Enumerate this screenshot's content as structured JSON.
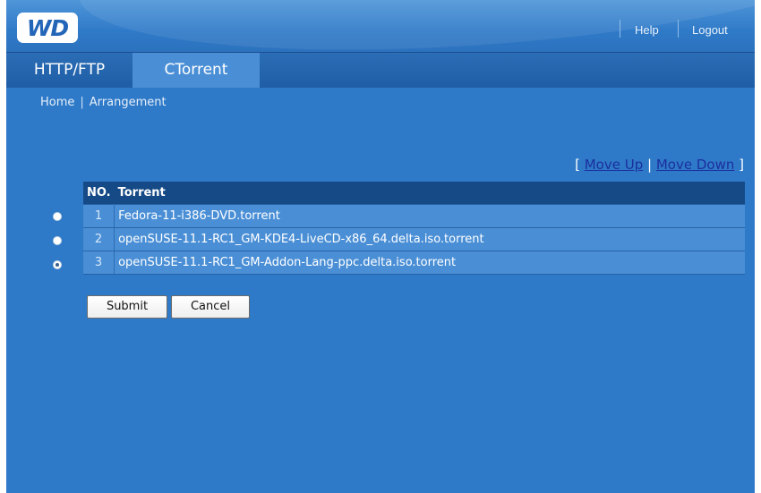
{
  "header": {
    "logo_text": "WD",
    "help_label": "Help",
    "logout_label": "Logout"
  },
  "tabs": [
    {
      "label": "HTTP/FTP",
      "active": false
    },
    {
      "label": "CTorrent",
      "active": true
    }
  ],
  "breadcrumb": {
    "home": "Home",
    "separator": "|",
    "current": "Arrangement"
  },
  "move_controls": {
    "open_bracket": "[",
    "move_up": "Move Up",
    "separator": "|",
    "move_down": "Move Down",
    "close_bracket": "]"
  },
  "table": {
    "headers": {
      "no": "NO.",
      "torrent": "Torrent"
    },
    "rows": [
      {
        "no": "1",
        "name": "Fedora-11-i386-DVD.torrent",
        "selected": false
      },
      {
        "no": "2",
        "name": "openSUSE-11.1-RC1_GM-KDE4-LiveCD-x86_64.delta.iso.torrent",
        "selected": false
      },
      {
        "no": "3",
        "name": "openSUSE-11.1-RC1_GM-Addon-Lang-ppc.delta.iso.torrent",
        "selected": true
      }
    ]
  },
  "buttons": {
    "submit": "Submit",
    "cancel": "Cancel"
  },
  "colors": {
    "background": "#2f7ac8",
    "tab_active": "#4a8fd6",
    "table_header": "#154a86",
    "link": "#1b2f9f"
  }
}
